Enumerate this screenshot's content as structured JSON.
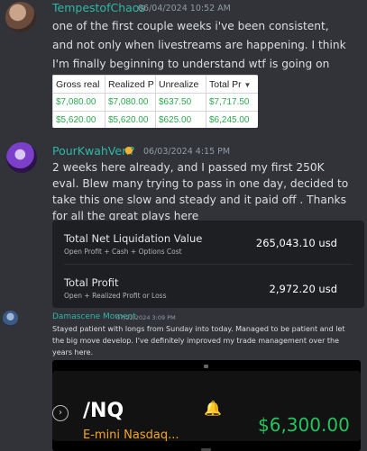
{
  "messages": [
    {
      "username": "TempestofChaos",
      "timestamp": "06/04/2024 10:52 AM",
      "lines": [
        "one of the first couple weeks i've been consistent,",
        "and not only when livestreams are happening.  I think",
        "I'm finally beginning to understand wtf is going on"
      ],
      "spreadsheet": {
        "headers": [
          "Gross real",
          "Realized P",
          "Unrealize",
          "Total Pr"
        ],
        "rows": [
          [
            "$7,080.00",
            "$7,080.00",
            "$637.50",
            "$7,717.50"
          ],
          [
            "$5,620.00",
            "$5,620.00",
            "$625.00",
            "$6,245.00"
          ]
        ]
      }
    },
    {
      "username": "PourKwahVen?",
      "badge": "●",
      "timestamp": "06/03/2024 4:15 PM",
      "lines": [
        "2 weeks here already, and I passed my first 250K",
        "eval. Blew many trying to pass in one day, decided to",
        "take this one slow and steady and it paid off . Thanks",
        "for all the great plays here"
      ],
      "account_card": {
        "row1": {
          "title": "Total Net Liquidation Value",
          "subtitle": "Open Profit + Cash + Options Cost",
          "value": "265,043.10 usd"
        },
        "row2": {
          "title": "Total Profit",
          "subtitle": "Open + Realized Profit or Loss",
          "value": "2,972.20 usd"
        }
      }
    },
    {
      "username": "Damascene Moment",
      "timestamp": "07/22/2024 3:09 PM",
      "lines": [
        "Stayed patient with longs from Sunday into today. Managed to be patient and let",
        "the big move develop. I've definitely improved my trade management over the",
        "years here."
      ],
      "quote": {
        "symbol": "/NQ",
        "description": "E-mini Nasdaq...",
        "price": "$6,300.00"
      }
    }
  ],
  "colors": {
    "background": "#313338",
    "username": "#2fb8a6",
    "positive": "#22c55e",
    "accent_orange": "#f5a623"
  },
  "icons": {
    "badge": "flame-badge-icon",
    "dropdown": "triangle-down-icon",
    "bell": "bell-icon",
    "chevron": "chevron-right-icon"
  }
}
